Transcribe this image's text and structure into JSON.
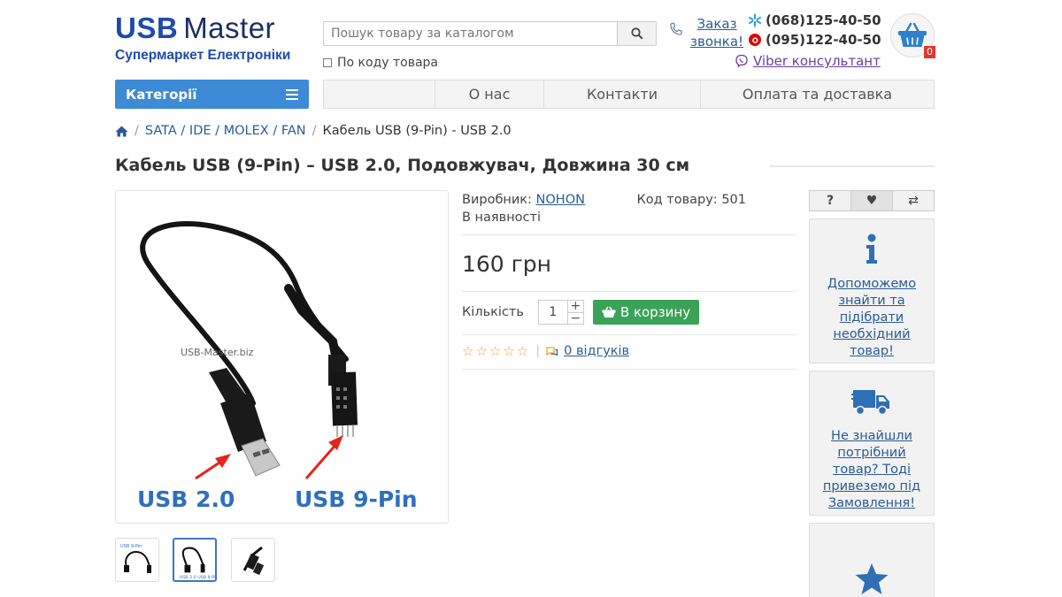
{
  "header": {
    "logo": {
      "usb": "USB",
      "master": "Master",
      "subtitle": "Супермаркет Електроніки"
    },
    "search": {
      "placeholder": "Пошук товару за каталогом",
      "code_label": "По коду товара"
    },
    "callback": {
      "label_line1": "Заказ",
      "label_line2": "звонка!"
    },
    "phones": [
      "(068)125-40-50",
      "(095)122-40-50"
    ],
    "viber_label": "Viber консультант",
    "cart_count": "0"
  },
  "nav": {
    "categories_label": "Категорії",
    "menu": [
      "О нас",
      "Контакти",
      "Оплата та доставка"
    ]
  },
  "breadcrumb": {
    "items": [
      "SATA / IDE / MOLEX / FAN"
    ],
    "current": "Кабель USB (9-Pin) - USB 2.0"
  },
  "product": {
    "title": "Кабель USB (9-Pin) – USB 2.0, Подовжувач, Довжина 30 см",
    "image": {
      "watermark": "USB-Master.biz",
      "label_left": "USB 2.0",
      "label_right": "USB 9-Pin"
    },
    "manufacturer_label": "Виробник:",
    "manufacturer": "NOHON",
    "code_label": "Код товару:",
    "code": "501",
    "availability": "В наявності",
    "price": "160 грн",
    "quantity_label": "Кількість",
    "quantity": "1",
    "add_to_cart": "В корзину",
    "reviews": "0 відгуків",
    "rating": 0
  },
  "sidebar": {
    "help_text": "Допоможемо знайти та підібрати необхідний товар!",
    "order_text": "Не знайшли потрібний товар? Тоді привеземо під Замовлення!"
  },
  "colors": {
    "brand_blue": "#1f4ba8",
    "accent_blue": "#3d8bd6",
    "green": "#3aa357",
    "link": "#2a5b96"
  }
}
